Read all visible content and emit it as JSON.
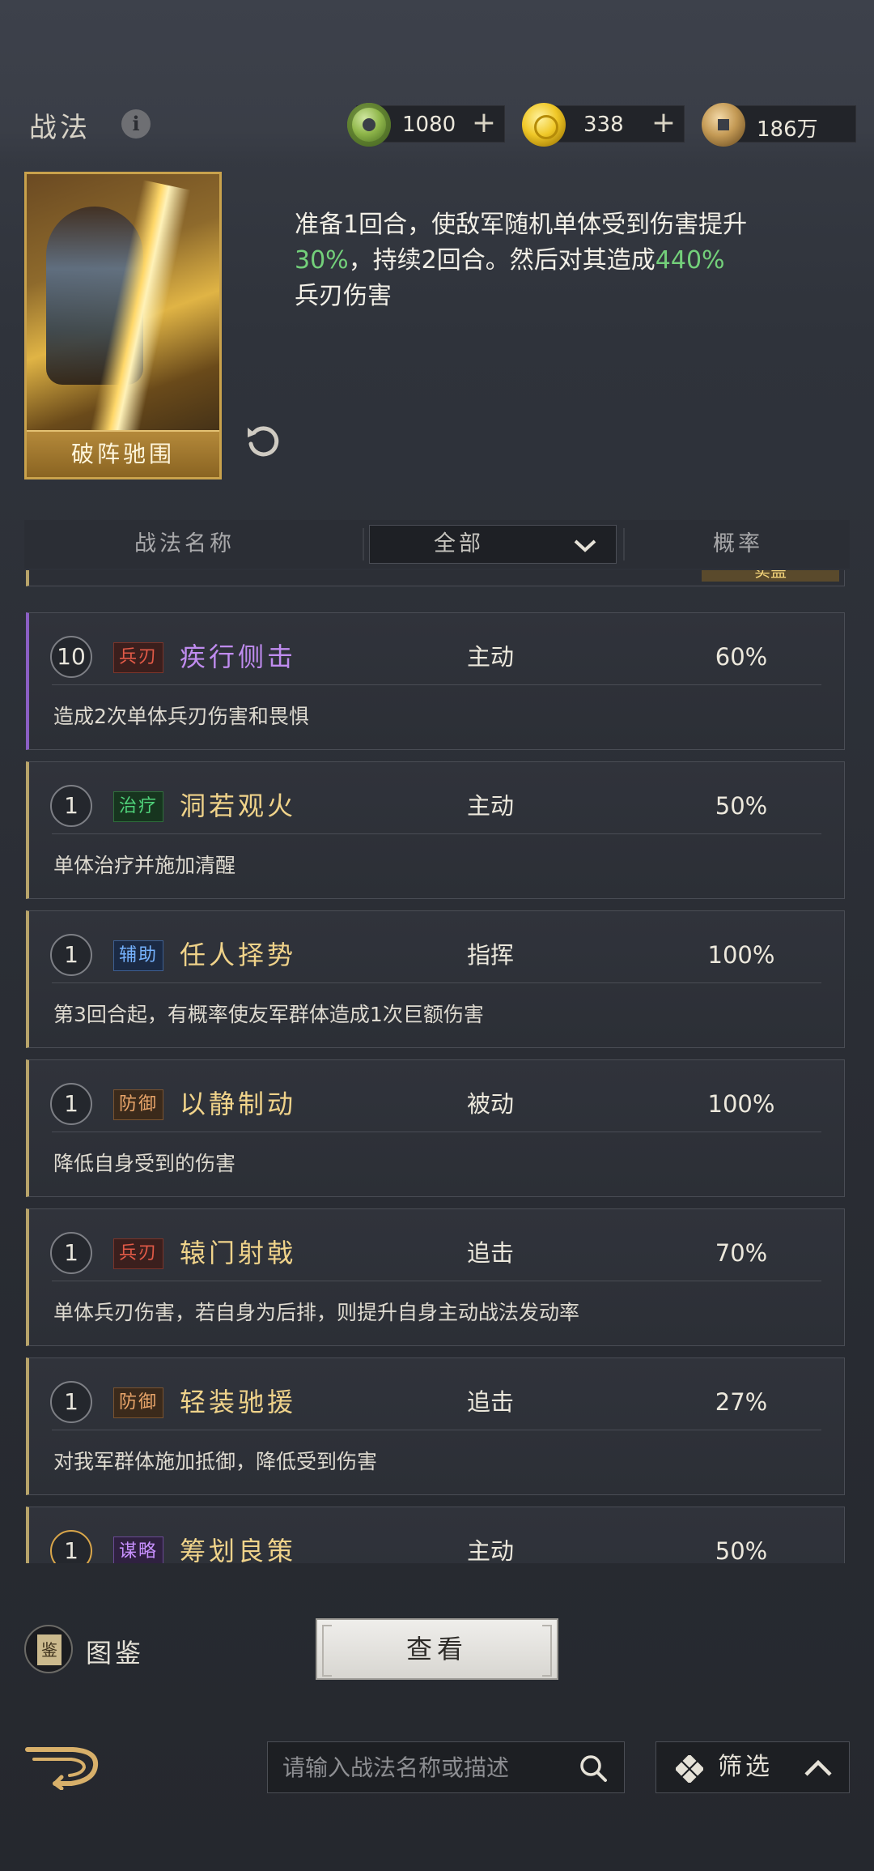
{
  "header": {
    "title": "战法",
    "resources": [
      {
        "icon": "jade-coin-icon",
        "value": "1080",
        "has_plus": true
      },
      {
        "icon": "gold-coin-icon",
        "value": "338",
        "has_plus": true
      },
      {
        "icon": "copper-coin-icon",
        "value": "186万",
        "has_plus": false
      }
    ]
  },
  "preview": {
    "card_name": "破阵驰围",
    "desc_part1": "准备1回合，使敌军随机单体受到伤害提升",
    "desc_green1": "30%",
    "desc_part2": "，持续2回合。然后对其造成",
    "desc_green2": "440%",
    "desc_part3": "兵刃伤害"
  },
  "table_header": {
    "col_name": "战法名称",
    "filter_value": "全部",
    "col_rate": "概率"
  },
  "partial_top_badge": "实盖",
  "skills": [
    {
      "level": "10",
      "tag": "兵刃",
      "tag_color": "red",
      "name": "疾行侧击",
      "name_color": "purple",
      "type": "主动",
      "rate": "60%",
      "desc": "造成2次单体兵刃伤害和畏惧"
    },
    {
      "level": "1",
      "tag": "治疗",
      "tag_color": "green",
      "name": "洞若观火",
      "name_color": "gold",
      "type": "主动",
      "rate": "50%",
      "desc": "单体治疗并施加清醒"
    },
    {
      "level": "1",
      "tag": "辅助",
      "tag_color": "blue",
      "name": "任人择势",
      "name_color": "gold",
      "type": "指挥",
      "rate": "100%",
      "desc": "第3回合起，有概率使友军群体造成1次巨额伤害"
    },
    {
      "level": "1",
      "tag": "防御",
      "tag_color": "orange",
      "name": "以静制动",
      "name_color": "gold",
      "type": "被动",
      "rate": "100%",
      "desc": "降低自身受到的伤害"
    },
    {
      "level": "1",
      "tag": "兵刃",
      "tag_color": "red",
      "name": "辕门射戟",
      "name_color": "gold",
      "type": "追击",
      "rate": "70%",
      "desc": "单体兵刃伤害，若自身为后排，则提升自身主动战法发动率"
    },
    {
      "level": "1",
      "tag": "防御",
      "tag_color": "orange",
      "name": "轻装驰援",
      "name_color": "gold",
      "type": "追击",
      "rate": "27%",
      "desc": "对我军群体施加抵御，降低受到伤害"
    },
    {
      "level": "1",
      "tag": "谋略",
      "tag_color": "purple",
      "name": "筹划良策",
      "name_color": "gold",
      "type": "主动",
      "rate": "50%",
      "desc": ""
    }
  ],
  "bottom": {
    "atlas_label": "图鉴",
    "view_button": "查看",
    "search_placeholder": "请输入战法名称或描述",
    "filter_label": "筛选"
  }
}
